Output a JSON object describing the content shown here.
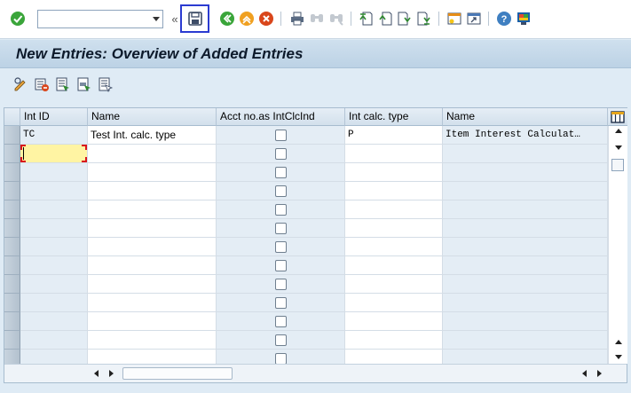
{
  "toolbar": {
    "command_field": {
      "value": "",
      "placeholder": ""
    },
    "buttons": [
      "enter-icon",
      "save-icon",
      "back-icon",
      "exit-icon",
      "cancel-icon",
      "print-icon",
      "find-icon",
      "find-next-icon",
      "first-page-icon",
      "previous-page-icon",
      "next-page-icon",
      "last-page-icon",
      "create-session-icon",
      "shortcut-icon",
      "help-icon",
      "customize-layout-icon"
    ],
    "accent_highlight": "#2b3bd1"
  },
  "title": "New Entries: Overview of Added Entries",
  "app_toolbar": {
    "buttons": [
      "change-display-icon",
      "delete-icon",
      "select-all-icon",
      "select-block-icon",
      "deselect-all-icon"
    ]
  },
  "table": {
    "columns": [
      "Int ID",
      "Name",
      "Acct no.as IntClcInd",
      "Int calc. type",
      "Name"
    ],
    "rows": [
      {
        "int_id": "TC",
        "name": "Test Int. calc. type",
        "acct_no": false,
        "int_calc_type": "P",
        "name2": "Item Interest Calculat…"
      }
    ],
    "empty_rows": 12
  },
  "colors": {
    "title_text": "#0d1a2b",
    "focus_cell": "#fff4a3",
    "focus_border": "#d9141b",
    "readonly_cell": "#e4edf5"
  }
}
